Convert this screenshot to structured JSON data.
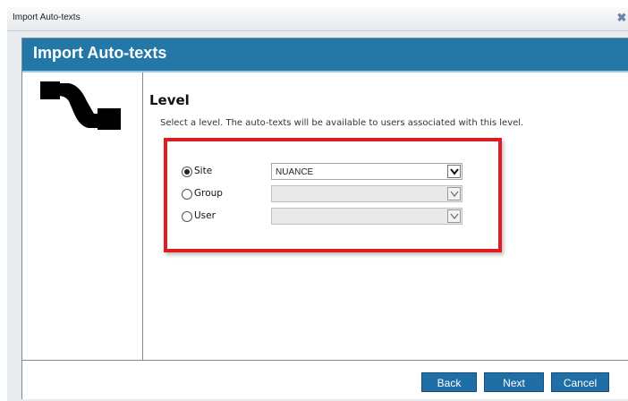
{
  "window": {
    "title": "Import Auto-texts",
    "close_glyph": "✖"
  },
  "dialog": {
    "header_title": "Import Auto-texts",
    "logo_icon": "auto-text-transfer-icon",
    "level_title": "Level",
    "instructions": "Select a level. The auto-texts will be available to users associated with this level.",
    "options": [
      {
        "label": "Site",
        "checked": true,
        "value": "NUANCE",
        "enabled": true
      },
      {
        "label": "Group",
        "checked": false,
        "value": "",
        "enabled": false
      },
      {
        "label": "User",
        "checked": false,
        "value": "",
        "enabled": false
      }
    ],
    "highlight_color": "#e01b22",
    "accent_color": "#2378a8"
  },
  "footer": {
    "back_label": "Back",
    "next_label": "Next",
    "cancel_label": "Cancel"
  }
}
